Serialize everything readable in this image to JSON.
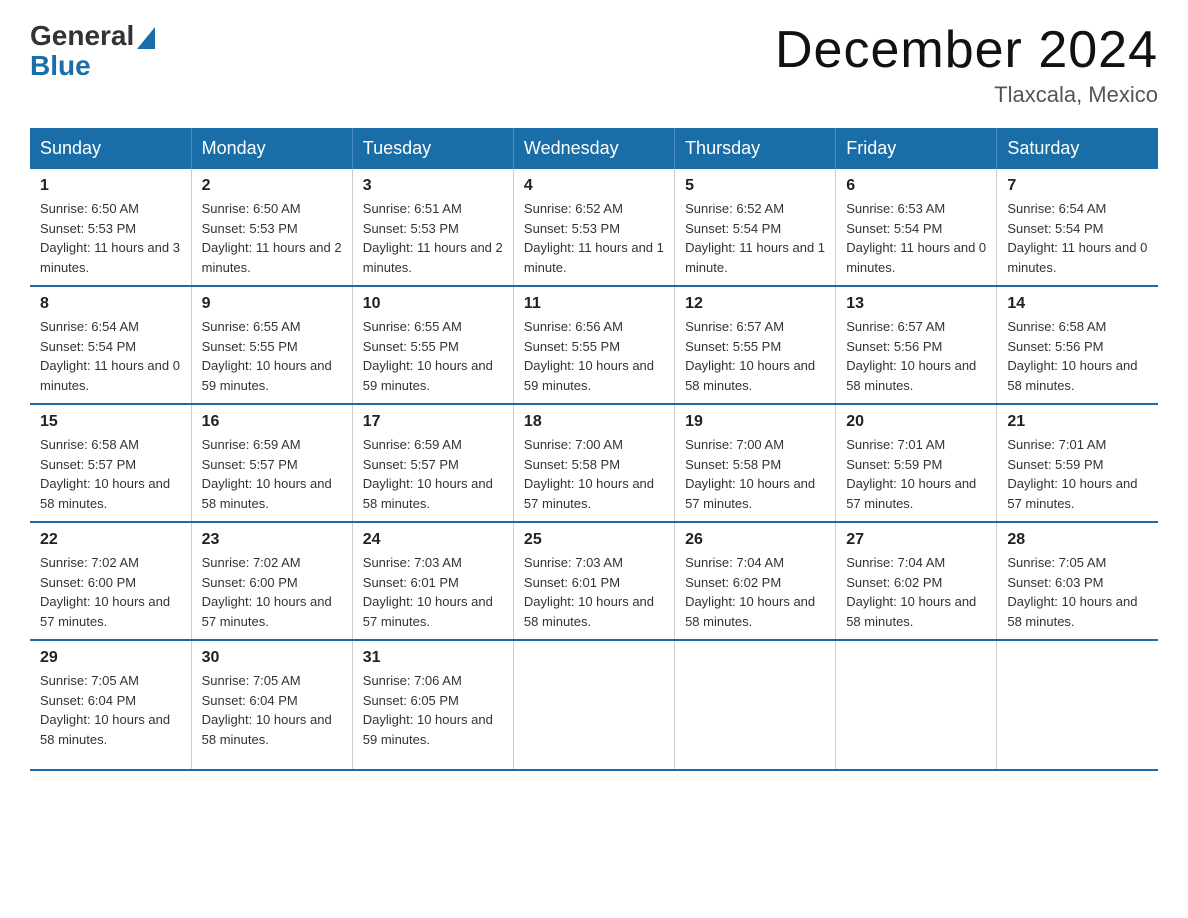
{
  "logo": {
    "general": "General",
    "blue": "Blue"
  },
  "title": "December 2024",
  "location": "Tlaxcala, Mexico",
  "days_of_week": [
    "Sunday",
    "Monday",
    "Tuesday",
    "Wednesday",
    "Thursday",
    "Friday",
    "Saturday"
  ],
  "weeks": [
    [
      {
        "day": "1",
        "sunrise": "6:50 AM",
        "sunset": "5:53 PM",
        "daylight": "11 hours and 3 minutes."
      },
      {
        "day": "2",
        "sunrise": "6:50 AM",
        "sunset": "5:53 PM",
        "daylight": "11 hours and 2 minutes."
      },
      {
        "day": "3",
        "sunrise": "6:51 AM",
        "sunset": "5:53 PM",
        "daylight": "11 hours and 2 minutes."
      },
      {
        "day": "4",
        "sunrise": "6:52 AM",
        "sunset": "5:53 PM",
        "daylight": "11 hours and 1 minute."
      },
      {
        "day": "5",
        "sunrise": "6:52 AM",
        "sunset": "5:54 PM",
        "daylight": "11 hours and 1 minute."
      },
      {
        "day": "6",
        "sunrise": "6:53 AM",
        "sunset": "5:54 PM",
        "daylight": "11 hours and 0 minutes."
      },
      {
        "day": "7",
        "sunrise": "6:54 AM",
        "sunset": "5:54 PM",
        "daylight": "11 hours and 0 minutes."
      }
    ],
    [
      {
        "day": "8",
        "sunrise": "6:54 AM",
        "sunset": "5:54 PM",
        "daylight": "11 hours and 0 minutes."
      },
      {
        "day": "9",
        "sunrise": "6:55 AM",
        "sunset": "5:55 PM",
        "daylight": "10 hours and 59 minutes."
      },
      {
        "day": "10",
        "sunrise": "6:55 AM",
        "sunset": "5:55 PM",
        "daylight": "10 hours and 59 minutes."
      },
      {
        "day": "11",
        "sunrise": "6:56 AM",
        "sunset": "5:55 PM",
        "daylight": "10 hours and 59 minutes."
      },
      {
        "day": "12",
        "sunrise": "6:57 AM",
        "sunset": "5:55 PM",
        "daylight": "10 hours and 58 minutes."
      },
      {
        "day": "13",
        "sunrise": "6:57 AM",
        "sunset": "5:56 PM",
        "daylight": "10 hours and 58 minutes."
      },
      {
        "day": "14",
        "sunrise": "6:58 AM",
        "sunset": "5:56 PM",
        "daylight": "10 hours and 58 minutes."
      }
    ],
    [
      {
        "day": "15",
        "sunrise": "6:58 AM",
        "sunset": "5:57 PM",
        "daylight": "10 hours and 58 minutes."
      },
      {
        "day": "16",
        "sunrise": "6:59 AM",
        "sunset": "5:57 PM",
        "daylight": "10 hours and 58 minutes."
      },
      {
        "day": "17",
        "sunrise": "6:59 AM",
        "sunset": "5:57 PM",
        "daylight": "10 hours and 58 minutes."
      },
      {
        "day": "18",
        "sunrise": "7:00 AM",
        "sunset": "5:58 PM",
        "daylight": "10 hours and 57 minutes."
      },
      {
        "day": "19",
        "sunrise": "7:00 AM",
        "sunset": "5:58 PM",
        "daylight": "10 hours and 57 minutes."
      },
      {
        "day": "20",
        "sunrise": "7:01 AM",
        "sunset": "5:59 PM",
        "daylight": "10 hours and 57 minutes."
      },
      {
        "day": "21",
        "sunrise": "7:01 AM",
        "sunset": "5:59 PM",
        "daylight": "10 hours and 57 minutes."
      }
    ],
    [
      {
        "day": "22",
        "sunrise": "7:02 AM",
        "sunset": "6:00 PM",
        "daylight": "10 hours and 57 minutes."
      },
      {
        "day": "23",
        "sunrise": "7:02 AM",
        "sunset": "6:00 PM",
        "daylight": "10 hours and 57 minutes."
      },
      {
        "day": "24",
        "sunrise": "7:03 AM",
        "sunset": "6:01 PM",
        "daylight": "10 hours and 57 minutes."
      },
      {
        "day": "25",
        "sunrise": "7:03 AM",
        "sunset": "6:01 PM",
        "daylight": "10 hours and 58 minutes."
      },
      {
        "day": "26",
        "sunrise": "7:04 AM",
        "sunset": "6:02 PM",
        "daylight": "10 hours and 58 minutes."
      },
      {
        "day": "27",
        "sunrise": "7:04 AM",
        "sunset": "6:02 PM",
        "daylight": "10 hours and 58 minutes."
      },
      {
        "day": "28",
        "sunrise": "7:05 AM",
        "sunset": "6:03 PM",
        "daylight": "10 hours and 58 minutes."
      }
    ],
    [
      {
        "day": "29",
        "sunrise": "7:05 AM",
        "sunset": "6:04 PM",
        "daylight": "10 hours and 58 minutes."
      },
      {
        "day": "30",
        "sunrise": "7:05 AM",
        "sunset": "6:04 PM",
        "daylight": "10 hours and 58 minutes."
      },
      {
        "day": "31",
        "sunrise": "7:06 AM",
        "sunset": "6:05 PM",
        "daylight": "10 hours and 59 minutes."
      },
      {
        "day": "",
        "sunrise": "",
        "sunset": "",
        "daylight": ""
      },
      {
        "day": "",
        "sunrise": "",
        "sunset": "",
        "daylight": ""
      },
      {
        "day": "",
        "sunrise": "",
        "sunset": "",
        "daylight": ""
      },
      {
        "day": "",
        "sunrise": "",
        "sunset": "",
        "daylight": ""
      }
    ]
  ]
}
